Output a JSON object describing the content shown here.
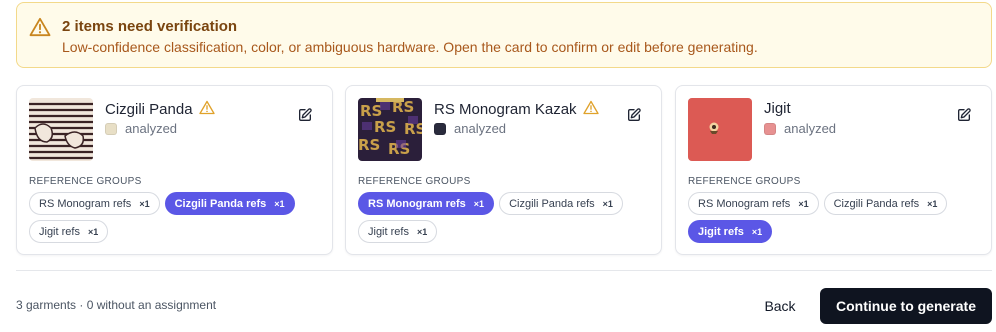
{
  "alert": {
    "title": "2 items need verification",
    "body": "Low-confidence classification, color, or ambiguous hardware. Open the card to confirm or edit before generating.",
    "icon": "warning-icon",
    "colors": {
      "bg": "#fffbea",
      "border": "#f3d98a",
      "title": "#7a4510",
      "body": "#a8581c"
    }
  },
  "ref_heading": "REFERENCE GROUPS",
  "cards": [
    {
      "name": "Cizgili Panda",
      "warning": true,
      "status": "analyzed",
      "swatch": "#e8dfc6",
      "chips": [
        {
          "label": "RS Monogram refs",
          "count": "×1",
          "selected": false
        },
        {
          "label": "Cizgili Panda refs",
          "count": "×1",
          "selected": true
        },
        {
          "label": "Jigit refs",
          "count": "×1",
          "selected": false
        }
      ]
    },
    {
      "name": "RS Monogram Kazak",
      "warning": true,
      "status": "analyzed",
      "swatch": "#2a2b3d",
      "chips": [
        {
          "label": "RS Monogram refs",
          "count": "×1",
          "selected": true
        },
        {
          "label": "Cizgili Panda refs",
          "count": "×1",
          "selected": false
        },
        {
          "label": "Jigit refs",
          "count": "×1",
          "selected": false
        }
      ]
    },
    {
      "name": "Jigit",
      "warning": false,
      "status": "analyzed",
      "swatch": "#e79191",
      "chips": [
        {
          "label": "RS Monogram refs",
          "count": "×1",
          "selected": false
        },
        {
          "label": "Cizgili Panda refs",
          "count": "×1",
          "selected": false
        },
        {
          "label": "Jigit refs",
          "count": "×1",
          "selected": true
        }
      ]
    }
  ],
  "footer": {
    "summary": "3 garments · 0 without an assignment",
    "back_label": "Back",
    "continue_label": "Continue to generate"
  },
  "accent": "#5b57e6"
}
